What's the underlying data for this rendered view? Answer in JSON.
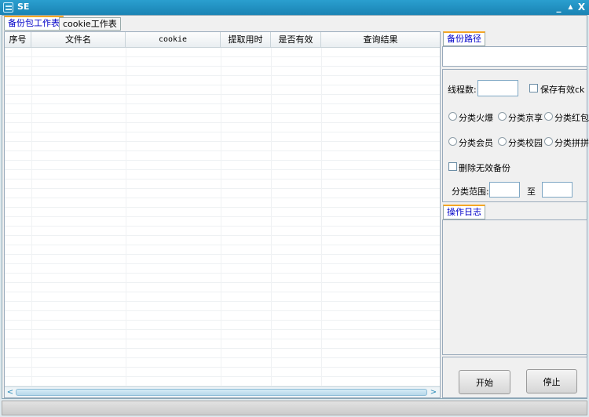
{
  "window": {
    "title": "SE",
    "minimize": "_",
    "maximize": "▲",
    "close": "X"
  },
  "tabs": [
    {
      "label": "备份包工作表"
    },
    {
      "label": "cookie工作表"
    }
  ],
  "table": {
    "columns": [
      "序号",
      "文件名",
      "cookie",
      "提取用时",
      "是否有效",
      "查询结果"
    ],
    "rows": []
  },
  "scroll": {
    "left": "<",
    "right": ">"
  },
  "backup_path": {
    "tab": "备份路径",
    "value": ""
  },
  "settings": {
    "threads_label": "线程数:",
    "threads_value": "",
    "save_valid_label": "保存有效ck",
    "radios": [
      "分类火爆",
      "分类京享",
      "分类红包",
      "分类会员",
      "分类校园",
      "分类拼拼"
    ],
    "delete_invalid_label": "删除无效备份",
    "range_label": "分类范围:",
    "range_from": "",
    "range_to_label": "至",
    "range_to": ""
  },
  "log": {
    "tab": "操作日志"
  },
  "buttons": {
    "start": "开始",
    "stop": "停止"
  }
}
